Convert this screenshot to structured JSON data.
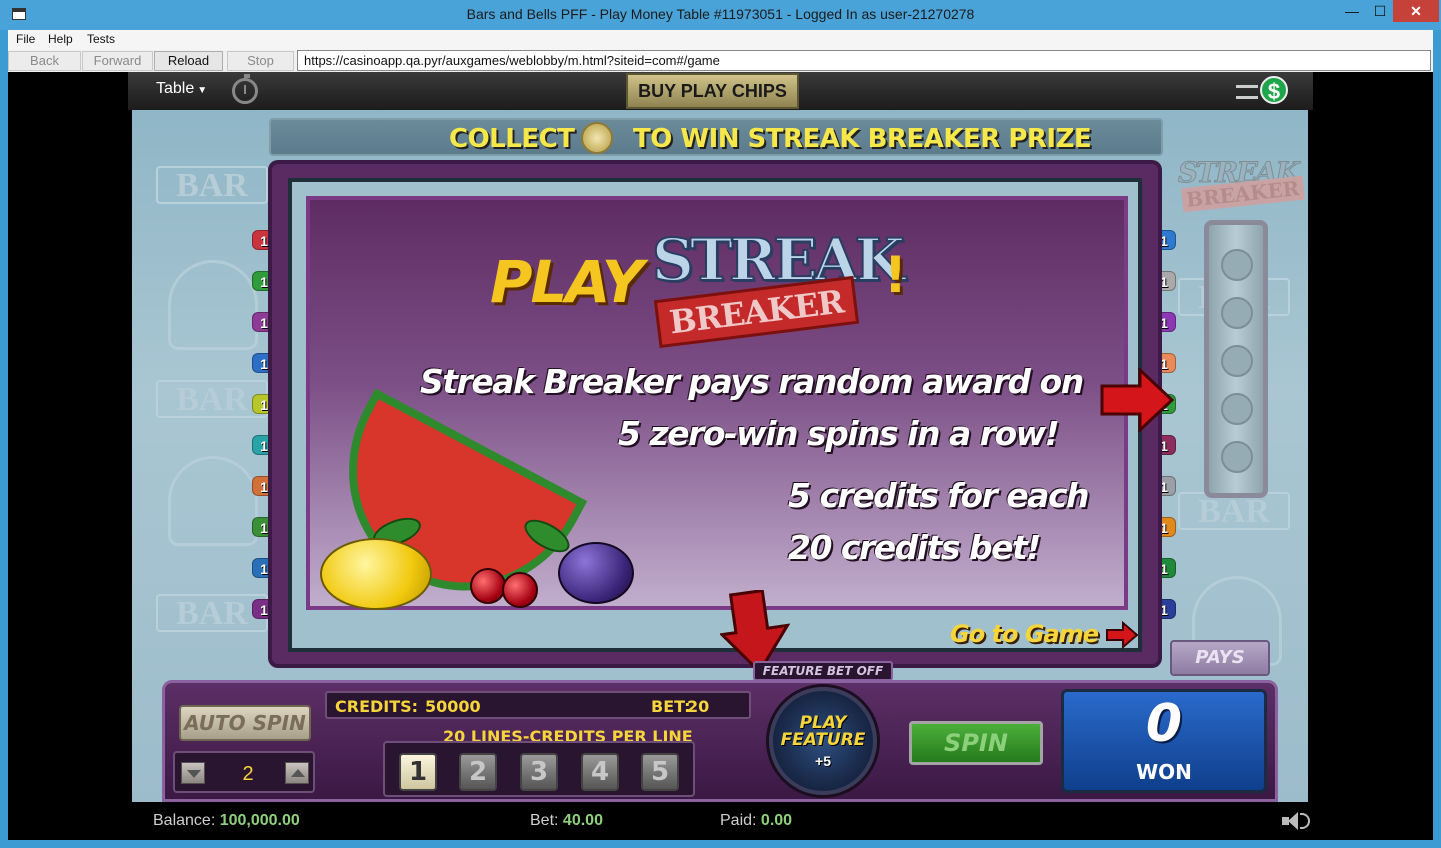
{
  "window": {
    "title": "Bars and Bells PFF - Play Money Table #11973051 - Logged In as user-21270278"
  },
  "menu": [
    "File",
    "Help",
    "Tests"
  ],
  "nav": {
    "back": "Back",
    "forward": "Forward",
    "reload": "Reload",
    "stop": "Stop",
    "url": "https://casinoapp.qa.pyr/auxgames/weblobby/m.html?siteid=com#/game"
  },
  "topbar": {
    "table_label": "Table",
    "buy_chips": "BUY PLAY CHIPS",
    "cashier_symbol": "$"
  },
  "collect": {
    "left": "COLLECT 5",
    "right": "TO WIN STREAK BREAKER PRIZE"
  },
  "bg": {
    "bar": "BAR"
  },
  "logo_small": {
    "streak": "STREAK",
    "breaker": "BREAKER"
  },
  "popup": {
    "play": "PLAY",
    "logo_streak": "STREAK",
    "logo_breaker": "BREAKER",
    "excl": "!",
    "line1": "Streak Breaker pays random award on",
    "line2": "5 zero-win spins in a row!",
    "line3": "5 credits for each",
    "line4": "20 credits bet!",
    "goto_game": "Go to Game"
  },
  "line_markers_left": [
    {
      "label": "1",
      "color": "#c9343d"
    },
    {
      "label": "1",
      "color": "#2f9b3a"
    },
    {
      "label": "1",
      "color": "#8e3a97"
    },
    {
      "label": "1",
      "color": "#2d6fc4"
    },
    {
      "label": "1",
      "color": "#b7c62a"
    },
    {
      "label": "1",
      "color": "#2aa3a8"
    },
    {
      "label": "1",
      "color": "#d2703a"
    },
    {
      "label": "1",
      "color": "#3b8f36"
    },
    {
      "label": "1",
      "color": "#2a70b8"
    },
    {
      "label": "1",
      "color": "#7a2f86"
    }
  ],
  "line_markers_right": [
    {
      "label": "1",
      "color": "#2d7ad0"
    },
    {
      "label": "1",
      "color": "#a9a9a9"
    },
    {
      "label": "1",
      "color": "#8c37b3"
    },
    {
      "label": "1",
      "color": "#ea8a5a"
    },
    {
      "label": "1",
      "color": "#2f9b3a"
    },
    {
      "label": "1",
      "color": "#8d2d5e"
    },
    {
      "label": "1",
      "color": "#9aa0a6"
    },
    {
      "label": "1",
      "color": "#e08a1d"
    },
    {
      "label": "1",
      "color": "#1f8a3a"
    },
    {
      "label": "1",
      "color": "#2a3f9a"
    }
  ],
  "console": {
    "auto_spin": "AUTO SPIN",
    "spin_count": "2",
    "credits_label": "CREDITS:",
    "credits_value": "50000",
    "bet_label": "BET:",
    "bet_value": "20",
    "lines_label": "20 LINES-CREDITS PER LINE",
    "line_buttons": [
      "1",
      "2",
      "3",
      "4",
      "5"
    ],
    "feature_bet": "FEATURE BET OFF",
    "play_feature": "PLAY FEATURE",
    "play_feature_sub": "+5",
    "spin": "SPIN",
    "won_value": "0",
    "won_label": "WON",
    "pays": "PAYS"
  },
  "status": {
    "balance_label": "Balance:",
    "balance_value": "100,000.00",
    "bet_label": "Bet:",
    "bet_value": "40.00",
    "paid_label": "Paid:",
    "paid_value": "0.00"
  }
}
